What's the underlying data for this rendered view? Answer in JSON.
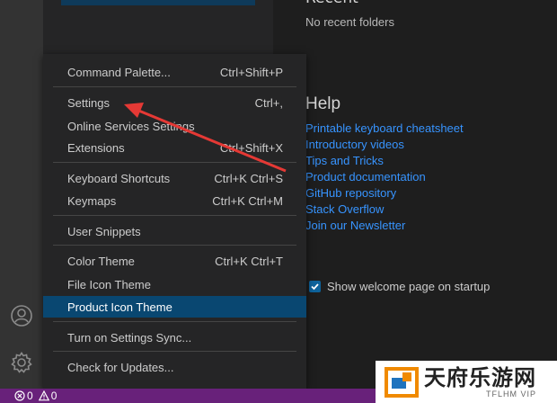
{
  "welcome": {
    "recent_heading": "Recent",
    "no_recent": "No recent folders",
    "help_heading": "Help",
    "help_links": [
      "Printable keyboard cheatsheet",
      "Introductory videos",
      "Tips and Tricks",
      "Product documentation",
      "GitHub repository",
      "Stack Overflow",
      "Join our Newsletter"
    ],
    "show_welcome_label": "Show welcome page on startup",
    "show_welcome_checked": true
  },
  "menu": {
    "items": [
      {
        "label": "Command Palette...",
        "shortcut": "Ctrl+Shift+P"
      },
      {
        "label": "Settings",
        "shortcut": "Ctrl+,"
      },
      {
        "label": "Online Services Settings",
        "shortcut": ""
      },
      {
        "label": "Extensions",
        "shortcut": "Ctrl+Shift+X"
      },
      {
        "label": "Keyboard Shortcuts",
        "shortcut": "Ctrl+K Ctrl+S"
      },
      {
        "label": "Keymaps",
        "shortcut": "Ctrl+K Ctrl+M"
      },
      {
        "label": "User Snippets",
        "shortcut": ""
      },
      {
        "label": "Color Theme",
        "shortcut": "Ctrl+K Ctrl+T"
      },
      {
        "label": "File Icon Theme",
        "shortcut": ""
      },
      {
        "label": "Product Icon Theme",
        "shortcut": ""
      },
      {
        "label": "Turn on Settings Sync...",
        "shortcut": ""
      },
      {
        "label": "Check for Updates...",
        "shortcut": ""
      }
    ],
    "active_label": "Product Icon Theme"
  },
  "status_bar": {
    "errors": "0",
    "warnings": "0"
  },
  "icons": {
    "account": "account-icon",
    "manage": "gear-icon",
    "error": "error-icon",
    "warning": "warning-icon"
  },
  "colors": {
    "status_bar": "#68217a",
    "menu_active": "#094771",
    "link": "#3794ff",
    "annotation_arrow": "#e53935"
  },
  "watermark": {
    "text_cn": "天府乐游网",
    "text_en": "TFLHM VIP"
  }
}
